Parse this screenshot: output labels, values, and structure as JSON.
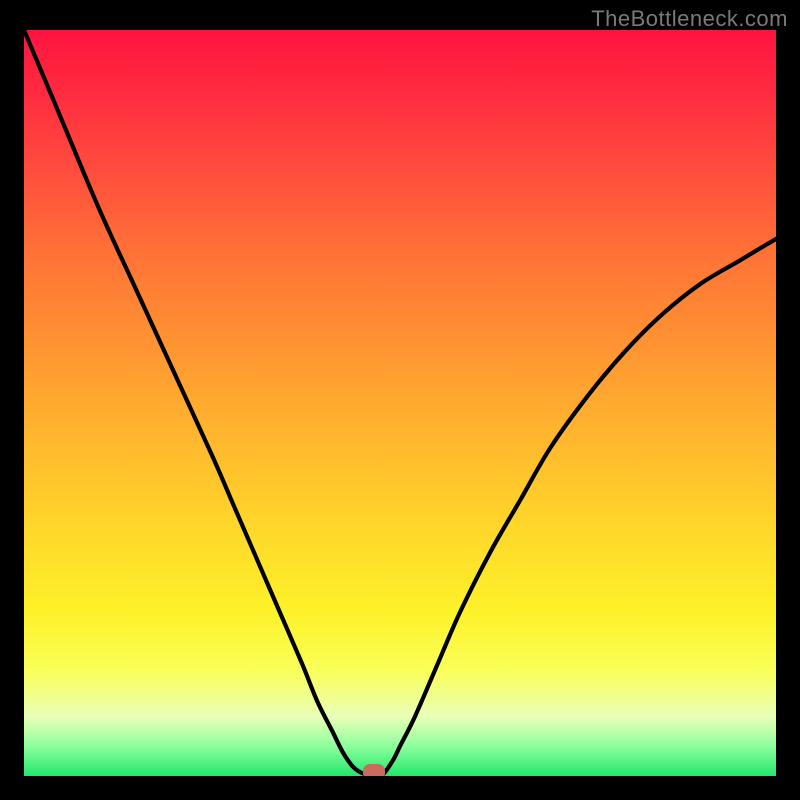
{
  "watermark": "TheBottleneck.com",
  "chart_data": {
    "type": "line",
    "title": "",
    "xlabel": "",
    "ylabel": "",
    "xlim": [
      0,
      100
    ],
    "ylim": [
      0,
      100
    ],
    "grid": false,
    "legend": false,
    "background_gradient": {
      "colors": [
        "#ff1440",
        "#ffb52e",
        "#fdf229",
        "#22e76c"
      ],
      "direction": "top-to-bottom",
      "meaning": "red=high bottleneck, green=low bottleneck"
    },
    "series": [
      {
        "name": "bottleneck-curve",
        "x": [
          0,
          5,
          10,
          15,
          20,
          25,
          28,
          31,
          34,
          37,
          39,
          41,
          42.5,
          44,
          46,
          47.5,
          49,
          50,
          52,
          55,
          58,
          62,
          66,
          70,
          75,
          80,
          85,
          90,
          95,
          100
        ],
        "values": [
          100,
          88,
          76,
          65,
          54,
          43,
          36,
          29,
          22,
          15,
          10,
          6,
          3,
          1,
          0,
          0,
          2,
          4,
          8,
          15,
          22,
          30,
          37,
          44,
          51,
          57,
          62,
          66,
          69,
          72
        ]
      }
    ],
    "marker": {
      "x": 46.5,
      "y": 0,
      "color": "#cc6a5f"
    }
  }
}
